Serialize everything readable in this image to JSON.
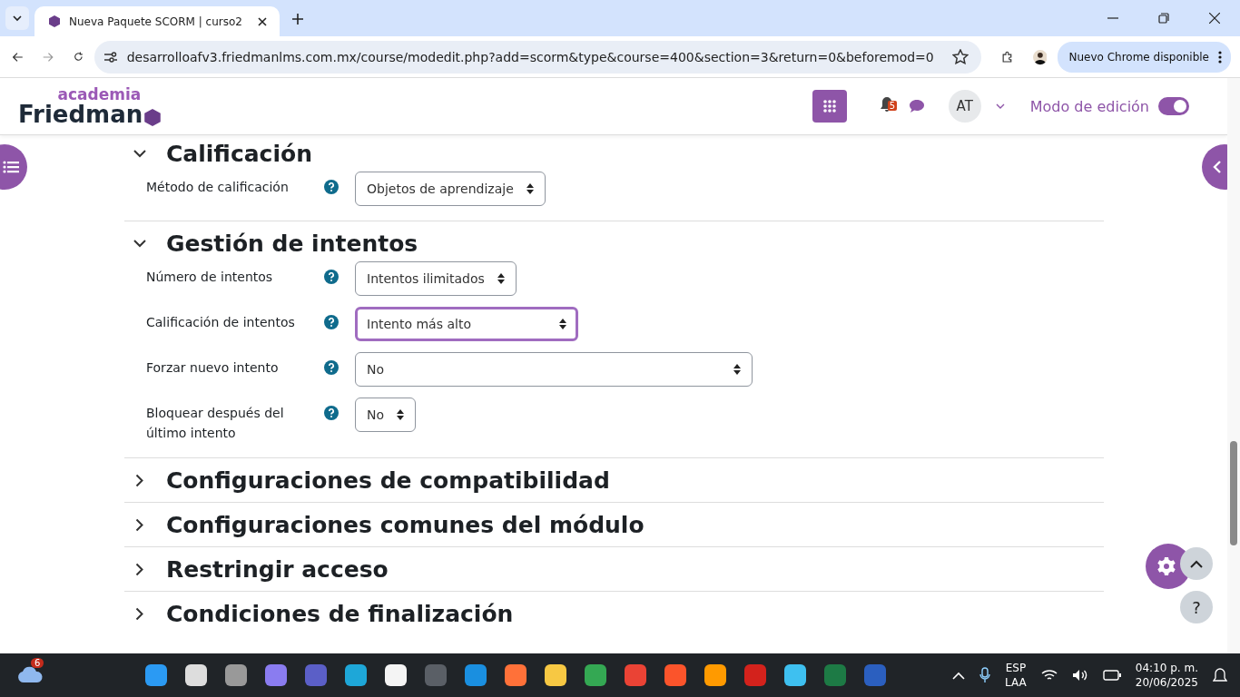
{
  "browser": {
    "tabs": [
      {
        "title": "Nueva Paquete SCORM | curso2",
        "selected": true
      }
    ],
    "url": "desarrolloafv3.friedmanlms.com.mx/course/modedit.php?add=scorm&type&course=400&section=3&return=0&beforemod=0",
    "update_button": "Nuevo Chrome disponible"
  },
  "header": {
    "logo_top": "academia",
    "logo_bottom": "Friedman",
    "notifications": "5",
    "user_initials": "AT",
    "edit_mode": {
      "label": "Modo de edición",
      "on": true
    }
  },
  "sections": [
    {
      "title": "Calificación",
      "expanded": true,
      "fields": [
        {
          "label": "Método de calificación",
          "value": "Objetos de aprendizaje",
          "focused": false
        }
      ]
    },
    {
      "title": "Gestión de intentos",
      "expanded": true,
      "fields": [
        {
          "label": "Número de intentos",
          "value": "Intentos ilimitados",
          "focused": false
        },
        {
          "label": "Calificación de intentos",
          "value": "Intento más alto",
          "focused": true
        },
        {
          "label": "Forzar nuevo intento",
          "value": "No",
          "focused": false
        },
        {
          "label": "Bloquear después del último intento",
          "value": "No",
          "focused": false
        }
      ]
    },
    {
      "title": "Configuraciones de compatibilidad",
      "expanded": false
    },
    {
      "title": "Configuraciones comunes del módulo",
      "expanded": false
    },
    {
      "title": "Restringir acceso",
      "expanded": false
    },
    {
      "title": "Condiciones de finalización",
      "expanded": false
    }
  ],
  "help_button": "?",
  "taskbar": {
    "weather_badge": "6",
    "language": "ESP",
    "layout": "LAA",
    "time": "04:10 p. m.",
    "date": "20/06/2025"
  }
}
